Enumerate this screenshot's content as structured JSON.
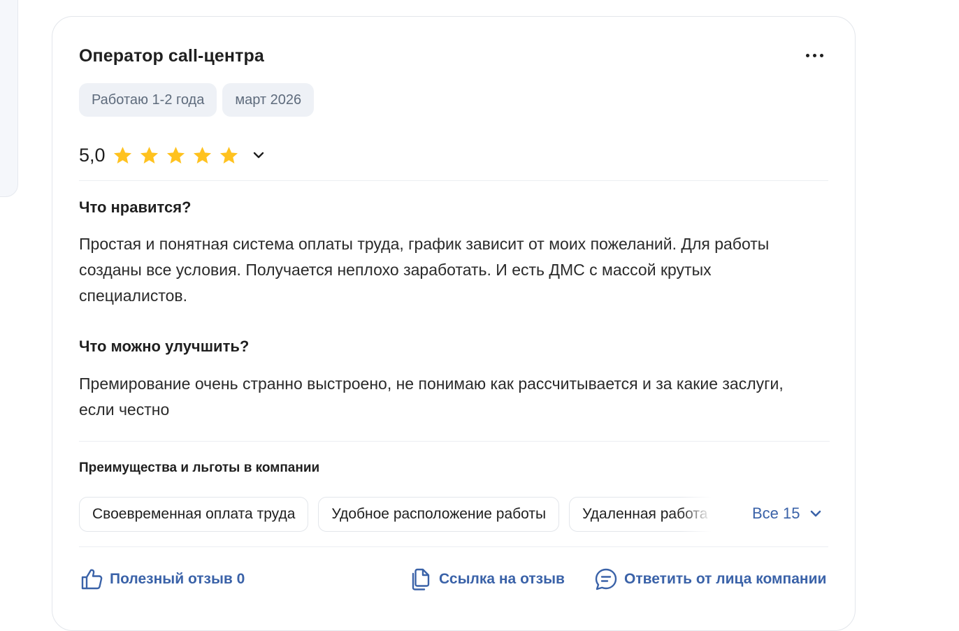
{
  "review": {
    "title": "Оператор call-центра",
    "tags": [
      "Работаю 1-2 года",
      "март 2026"
    ],
    "rating": "5,0",
    "rating_stars": 5,
    "star_color": "#ffc21f",
    "sections": [
      {
        "question": "Что нравится?",
        "answer": "Простая и понятная система оплаты труда, график зависит от моих пожеланий. Для работы созданы все условия. Получается неплохо заработать. И есть ДМС с массой крутых специалистов."
      },
      {
        "question": "Что можно улучшить?",
        "answer": "Премирование очень странно выстроено, не понимаю как рассчитывается и за какие заслуги, если честно"
      }
    ]
  },
  "benefits": {
    "title": "Преимущества и льготы в компании",
    "items": [
      "Своевременная оплата труда",
      "Удобное расположение работы",
      "Удаленная работа"
    ],
    "all_label": "Все 15"
  },
  "actions": {
    "helpful": "Полезный отзыв 0",
    "link": "Ссылка на отзыв",
    "reply": "Ответить от лица компании"
  },
  "colors": {
    "accent": "#3a62a8",
    "tag_bg": "#eef1f6",
    "tag_text": "#5e6b7c"
  },
  "icons": {
    "menu": "more-dots-icon",
    "star": "star-icon",
    "expand": "chevron-down-icon",
    "helpful": "thumbs-up-icon",
    "link": "copy-link-icon",
    "reply": "chat-bubble-icon"
  }
}
